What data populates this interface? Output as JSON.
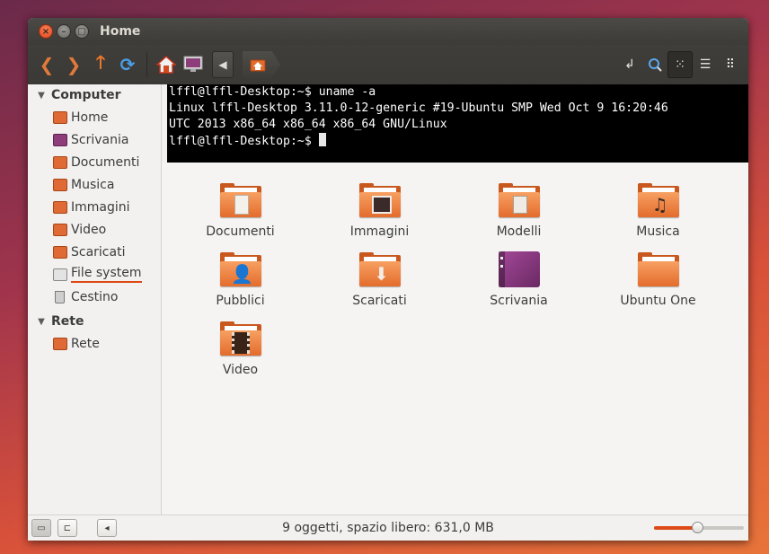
{
  "window": {
    "title": "Home"
  },
  "toolbar": {
    "back_icon": "chevron-left-icon",
    "forward_icon": "chevron-right-icon",
    "up_icon": "arrow-up-icon",
    "reload_icon": "reload-icon",
    "path_left_icon": "triangle-left-icon"
  },
  "sidebar": {
    "computer": {
      "label": "Computer",
      "items": [
        {
          "label": "Home",
          "icon": "home-folder-icon"
        },
        {
          "label": "Scrivania",
          "icon": "desktop-icon"
        },
        {
          "label": "Documenti",
          "icon": "documents-folder-icon"
        },
        {
          "label": "Musica",
          "icon": "music-folder-icon"
        },
        {
          "label": "Immagini",
          "icon": "pictures-folder-icon"
        },
        {
          "label": "Video",
          "icon": "video-folder-icon"
        },
        {
          "label": "Scaricati",
          "icon": "downloads-folder-icon"
        },
        {
          "label": "File system",
          "icon": "drive-icon"
        },
        {
          "label": "Cestino",
          "icon": "trash-icon"
        }
      ]
    },
    "network": {
      "label": "Rete",
      "items": [
        {
          "label": "Rete",
          "icon": "network-icon"
        }
      ]
    }
  },
  "terminal": {
    "line1": "lffl@lffl-Desktop:~$ uname -a",
    "line2": "Linux lffl-Desktop 3.11.0-12-generic #19-Ubuntu SMP Wed Oct 9 16:20:46",
    "line3": "UTC 2013 x86_64 x86_64 x86_64 GNU/Linux",
    "line4": "lffl@lffl-Desktop:~$ "
  },
  "files": [
    {
      "label": "Documenti",
      "emblem": "document-icon"
    },
    {
      "label": "Immagini",
      "emblem": "picture-icon"
    },
    {
      "label": "Modelli",
      "emblem": "template-icon"
    },
    {
      "label": "Musica",
      "emblem": "music-note-icon"
    },
    {
      "label": "Pubblici",
      "emblem": "person-icon"
    },
    {
      "label": "Scaricati",
      "emblem": "download-arrow-icon"
    },
    {
      "label": "Scrivania",
      "emblem": "desktop-icon"
    },
    {
      "label": "Ubuntu One",
      "emblem": "folder-icon"
    },
    {
      "label": "Video",
      "emblem": "film-icon"
    }
  ],
  "status": {
    "text": "9 oggetti, spazio libero: 631,0 MB",
    "zoom_level": 0.48
  },
  "colors": {
    "accent": "#dd4814",
    "folder": "#e36c2c",
    "titlebar": "#3c3b37"
  }
}
